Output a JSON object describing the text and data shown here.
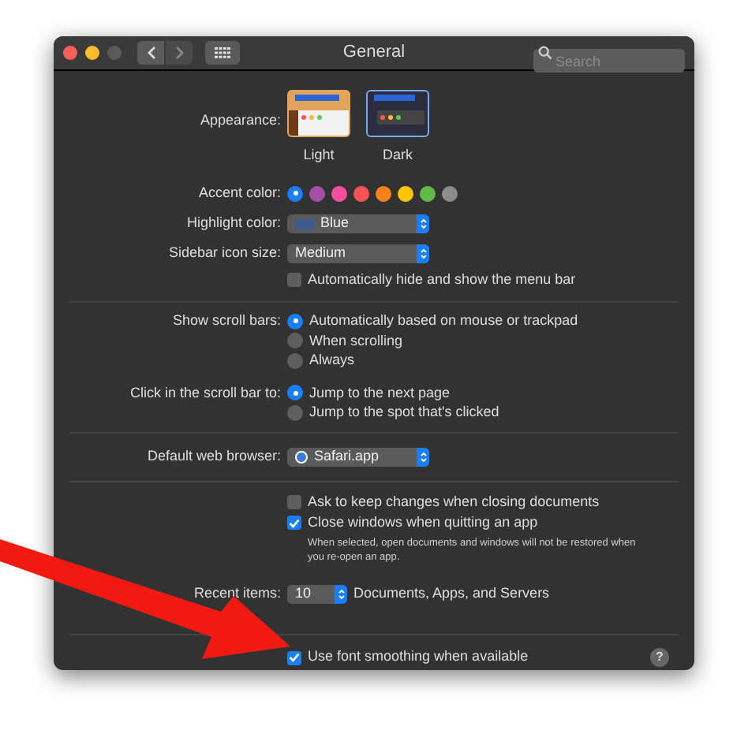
{
  "window": {
    "title": "General",
    "search": {
      "placeholder": "Search"
    }
  },
  "appearance": {
    "label": "Appearance:",
    "options": [
      {
        "label": "Light",
        "selected": false
      },
      {
        "label": "Dark",
        "selected": true
      }
    ]
  },
  "accent_color": {
    "label": "Accent color:",
    "options": [
      {
        "color": "#1a7ff5",
        "selected": true
      },
      {
        "color": "#a550a7",
        "selected": false
      },
      {
        "color": "#f74f9e",
        "selected": false
      },
      {
        "color": "#ff5257",
        "selected": false
      },
      {
        "color": "#f7821b",
        "selected": false
      },
      {
        "color": "#ffc600",
        "selected": false
      },
      {
        "color": "#62ba46",
        "selected": false
      },
      {
        "color": "#8c8c8c",
        "selected": false
      }
    ]
  },
  "highlight_color": {
    "label": "Highlight color:",
    "value": "Blue"
  },
  "sidebar_icon_size": {
    "label": "Sidebar icon size:",
    "value": "Medium"
  },
  "menu_bar": {
    "label": "Automatically hide and show the menu bar",
    "checked": false
  },
  "show_scroll_bars": {
    "label": "Show scroll bars:",
    "options": [
      {
        "label": "Automatically based on mouse or trackpad",
        "selected": true
      },
      {
        "label": "When scrolling",
        "selected": false
      },
      {
        "label": "Always",
        "selected": false
      }
    ]
  },
  "click_scroll_bar": {
    "label": "Click in the scroll bar to:",
    "options": [
      {
        "label": "Jump to the next page",
        "selected": true
      },
      {
        "label": "Jump to the spot that's clicked",
        "selected": false
      }
    ]
  },
  "default_browser": {
    "label": "Default web browser:",
    "value": "Safari.app"
  },
  "documents": [
    {
      "label": "Ask to keep changes when closing documents",
      "checked": false
    },
    {
      "label": "Close windows when quitting an app",
      "checked": true
    }
  ],
  "documents_note": "When selected, open documents and windows will not be restored when you re-open an app.",
  "recent_items": {
    "label": "Recent items:",
    "value": "10",
    "suffix": "Documents, Apps, and Servers"
  },
  "font_smoothing": {
    "label": "Use font smoothing when available",
    "checked": true
  },
  "help": "?"
}
